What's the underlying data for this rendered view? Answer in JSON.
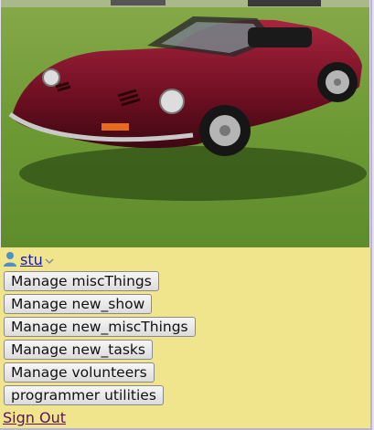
{
  "photo": {
    "icon": "car-photo"
  },
  "user": {
    "name": "stu",
    "icon": "user-icon",
    "menu_icon": "chevron-down-icon"
  },
  "menu": {
    "items": [
      {
        "label": "Manage miscThings"
      },
      {
        "label": "Manage new_show"
      },
      {
        "label": "Manage new_miscThings"
      },
      {
        "label": "Manage new_tasks"
      },
      {
        "label": "Manage volunteers"
      },
      {
        "label": "programmer utilities"
      }
    ]
  },
  "sign_out_label": "Sign Out",
  "colors": {
    "panel": "#f0e58c",
    "link": "#1a1aa6",
    "visited_link": "#5a0f6e"
  }
}
